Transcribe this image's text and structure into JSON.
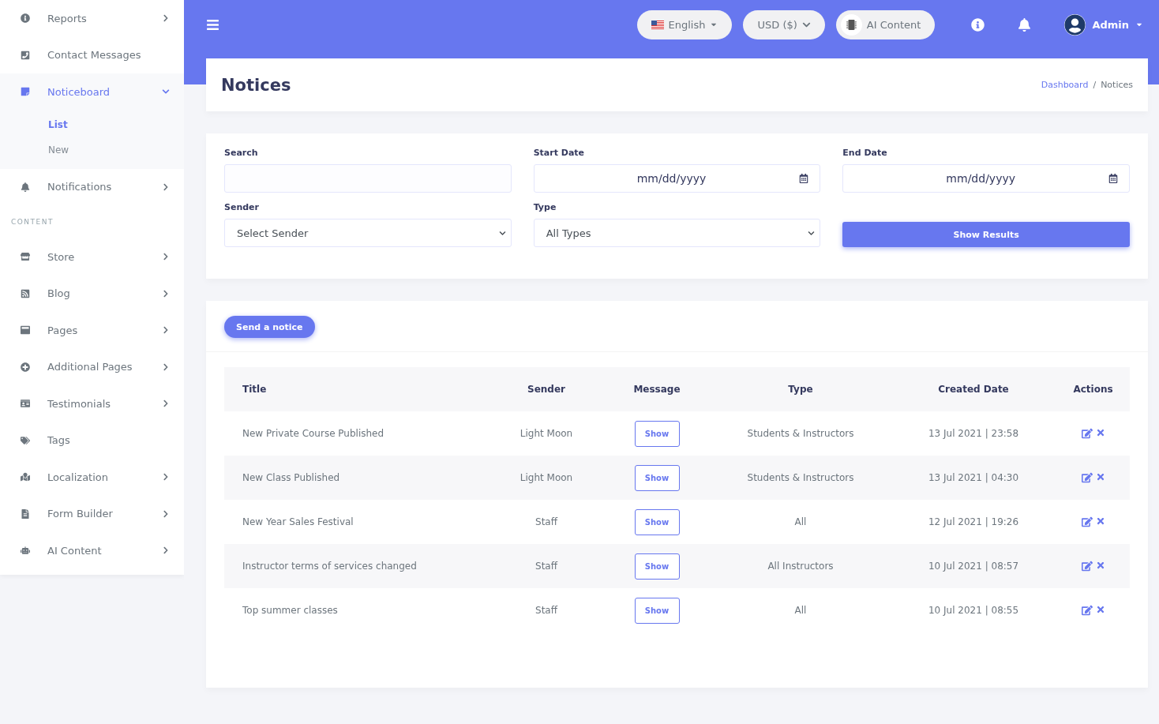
{
  "sidebar": {
    "items": [
      {
        "kind": "link",
        "label": "Reports",
        "expandable": true,
        "expanded": false,
        "selected": false
      },
      {
        "kind": "link",
        "label": "Contact Messages",
        "expandable": false,
        "selected": false
      },
      {
        "kind": "link",
        "label": "Noticeboard",
        "expandable": true,
        "expanded": true,
        "selected": true,
        "children": [
          {
            "label": "List",
            "selected": true
          },
          {
            "label": "New",
            "selected": false
          }
        ]
      },
      {
        "kind": "link",
        "label": "Notifications",
        "expandable": true,
        "expanded": false,
        "selected": false
      },
      {
        "kind": "heading",
        "label": "CONTENT"
      },
      {
        "kind": "link",
        "label": "Store",
        "expandable": true,
        "expanded": false,
        "selected": false
      },
      {
        "kind": "link",
        "label": "Blog",
        "expandable": true,
        "expanded": false,
        "selected": false
      },
      {
        "kind": "link",
        "label": "Pages",
        "expandable": true,
        "expanded": false,
        "selected": false
      },
      {
        "kind": "link",
        "label": "Additional Pages",
        "expandable": true,
        "expanded": false,
        "selected": false
      },
      {
        "kind": "link",
        "label": "Testimonials",
        "expandable": true,
        "expanded": false,
        "selected": false
      },
      {
        "kind": "link",
        "label": "Tags",
        "expandable": false,
        "selected": false
      },
      {
        "kind": "link",
        "label": "Localization",
        "expandable": true,
        "expanded": false,
        "selected": false
      },
      {
        "kind": "link",
        "label": "Form Builder",
        "expandable": true,
        "expanded": false,
        "selected": false
      },
      {
        "kind": "link",
        "label": "AI Content",
        "expandable": true,
        "expanded": false,
        "selected": false
      }
    ]
  },
  "topbar": {
    "language": "English",
    "currency": "USD ($)",
    "ai_button": "AI Content",
    "user": "Admin"
  },
  "page": {
    "title": "Notices",
    "breadcrumb": [
      "Dashboard",
      "Notices"
    ],
    "breadcrumb_separator": "/"
  },
  "filters": {
    "search": {
      "label": "Search"
    },
    "start_date": {
      "label": "Start Date",
      "placeholder": "mm/dd/yyyy"
    },
    "end_date": {
      "label": "End Date",
      "placeholder": "mm/dd/yyyy"
    },
    "sender": {
      "label": "Sender",
      "value": "Select Sender"
    },
    "type": {
      "label": "Type",
      "value": "All Types"
    },
    "submit": "Show Results"
  },
  "send_button": "Send a notice",
  "table": {
    "columns": [
      "Title",
      "Sender",
      "Message",
      "Type",
      "Created Date",
      "Actions"
    ],
    "rows": [
      {
        "title": "New Private Course Published",
        "sender": "Light Moon",
        "message": "Show",
        "type": "Students & Instructors",
        "created": "13 Jul 2021 | 23:58"
      },
      {
        "title": "New Class Published",
        "sender": "Light Moon",
        "message": "Show",
        "type": "Students & Instructors",
        "created": "13 Jul 2021 | 04:30"
      },
      {
        "title": "New Year Sales Festival",
        "sender": "Staff",
        "message": "Show",
        "type": "All",
        "created": "12 Jul 2021 | 19:26"
      },
      {
        "title": "Instructor terms of services changed",
        "sender": "Staff",
        "message": "Show",
        "type": "All Instructors",
        "created": "10 Jul 2021 | 08:57"
      },
      {
        "title": "Top summer classes",
        "sender": "Staff",
        "message": "Show",
        "type": "All",
        "created": "10 Jul 2021 | 08:55"
      }
    ]
  }
}
